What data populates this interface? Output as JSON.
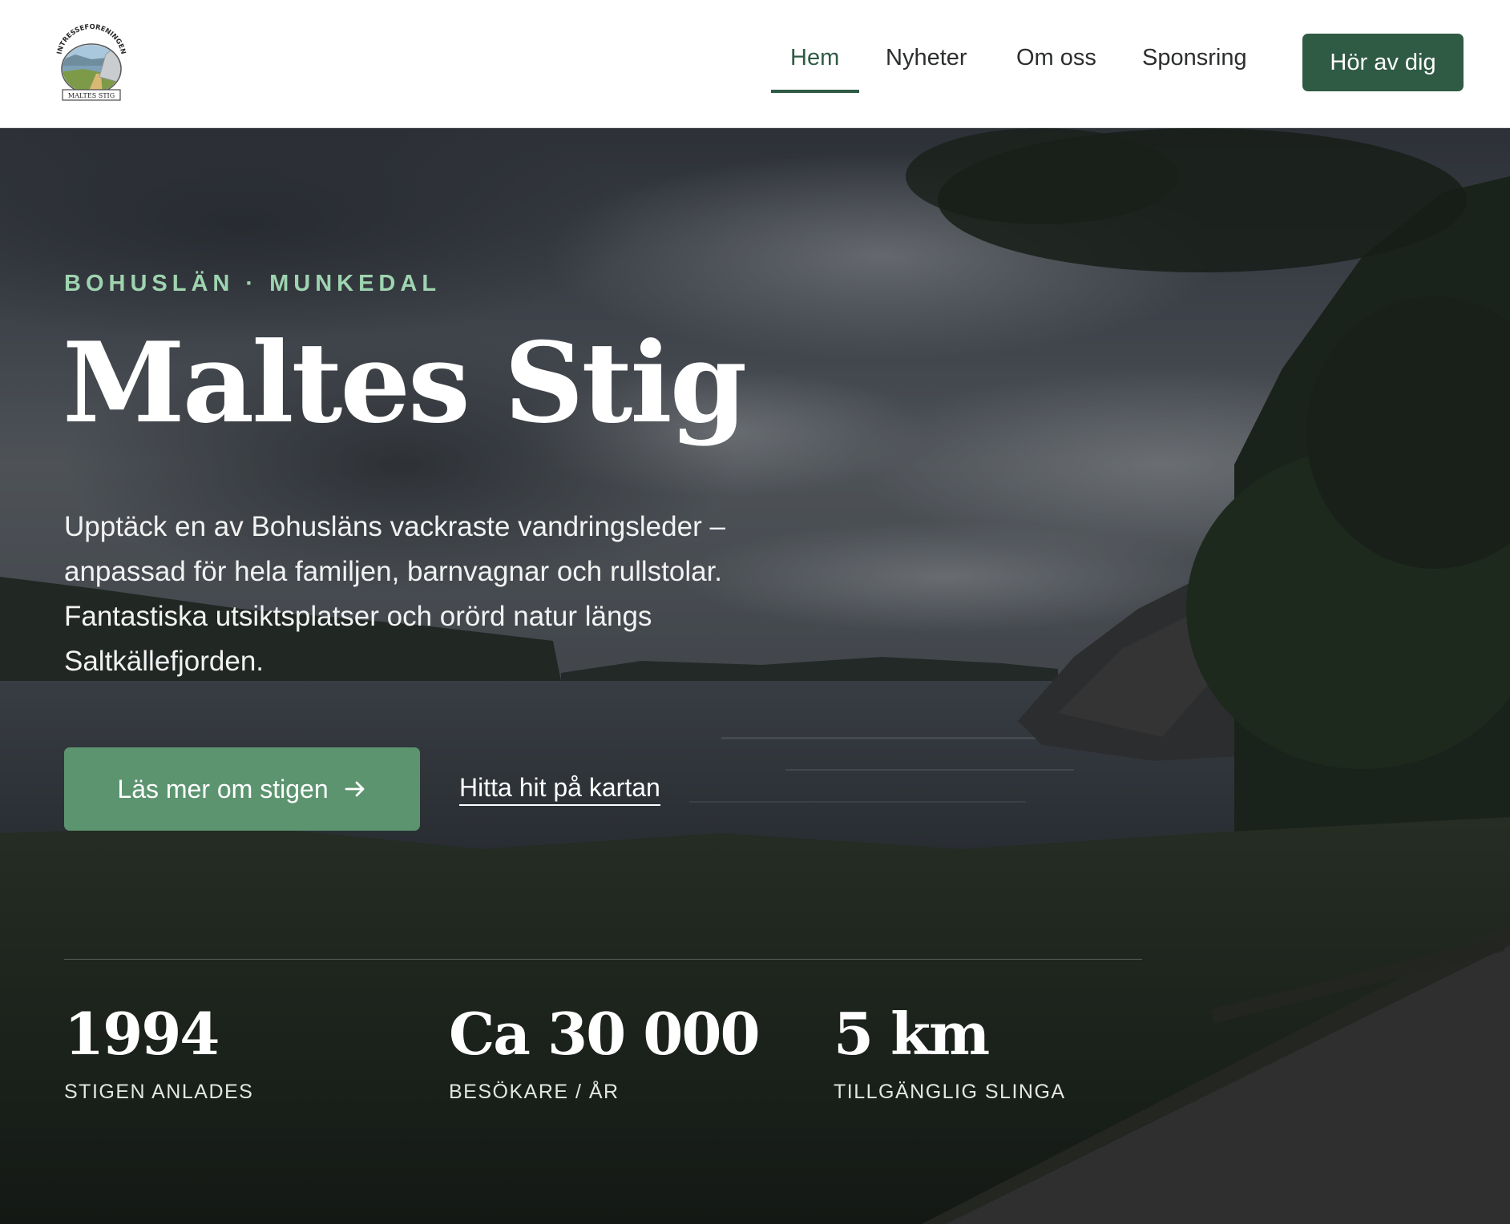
{
  "header": {
    "logo": {
      "icon": "maltes-stig-logo-icon",
      "arc_text": "INTRESSEFÖRENINGEN",
      "banner_text": "MALTES STIG"
    },
    "nav": [
      {
        "label": "Hem",
        "active": true
      },
      {
        "label": "Nyheter",
        "active": false
      },
      {
        "label": "Om oss",
        "active": false
      },
      {
        "label": "Sponsring",
        "active": false
      }
    ],
    "cta_label": "Hör av dig"
  },
  "hero": {
    "eyebrow": "BOHUSLÄN · MUNKEDAL",
    "title": "Maltes Stig",
    "description": "Upptäck en av Bohusläns vackraste vandringsleder – anpassad för hela familjen, barnvagnar och rullstolar. Fantastiska utsiktsplatser och orörd natur längs Saltkällefjorden.",
    "primary_button": {
      "label": "Läs mer om stigen",
      "icon": "arrow-right-icon"
    },
    "secondary_link": "Hitta hit på kartan",
    "background": "fjord-landscape-photo"
  },
  "stats": [
    {
      "value": "1994",
      "label": "STIGEN ANLADES"
    },
    {
      "value": "Ca 30 000",
      "label": "BESÖKARE / ÅR"
    },
    {
      "value": "5 km",
      "label": "TILLGÄNGLIG SLINGA"
    }
  ],
  "colors": {
    "brand_dark_green": "#2f5a44",
    "button_green": "#5c9470",
    "eyebrow_mint": "#9fd4b0"
  }
}
